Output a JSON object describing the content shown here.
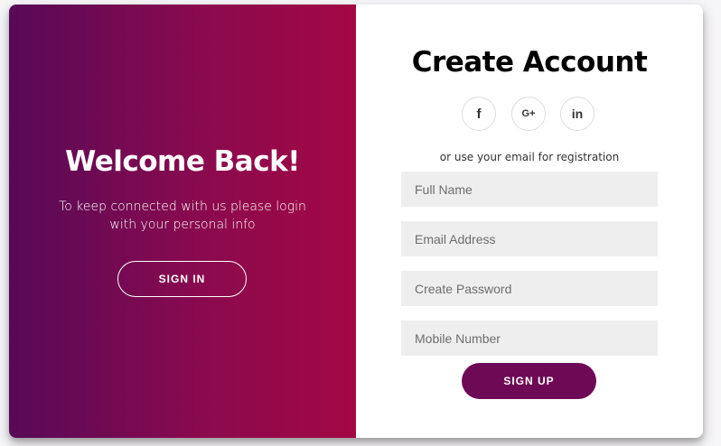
{
  "overlay": {
    "title": "Welcome Back!",
    "text": "To keep connected with us please login with your personal info",
    "signin_label": "SIGN IN"
  },
  "form": {
    "title": "Create Account",
    "social": [
      {
        "icon": "facebook-icon",
        "glyph": "f"
      },
      {
        "icon": "google-plus-icon",
        "glyph": "G+"
      },
      {
        "icon": "linkedin-icon",
        "glyph": "in"
      }
    ],
    "or_text": "or use your email for registration",
    "fields": [
      {
        "placeholder": "Full Name",
        "value": ""
      },
      {
        "placeholder": "Email Address",
        "value": ""
      },
      {
        "placeholder": "Create Password",
        "value": ""
      },
      {
        "placeholder": "Mobile Number",
        "value": ""
      }
    ],
    "signup_label": "SIGN UP"
  },
  "colors": {
    "gradient_start": "#570a57",
    "gradient_end": "#a20844",
    "signup_button": "#6e0a55",
    "field_background": "#eeeeee"
  }
}
